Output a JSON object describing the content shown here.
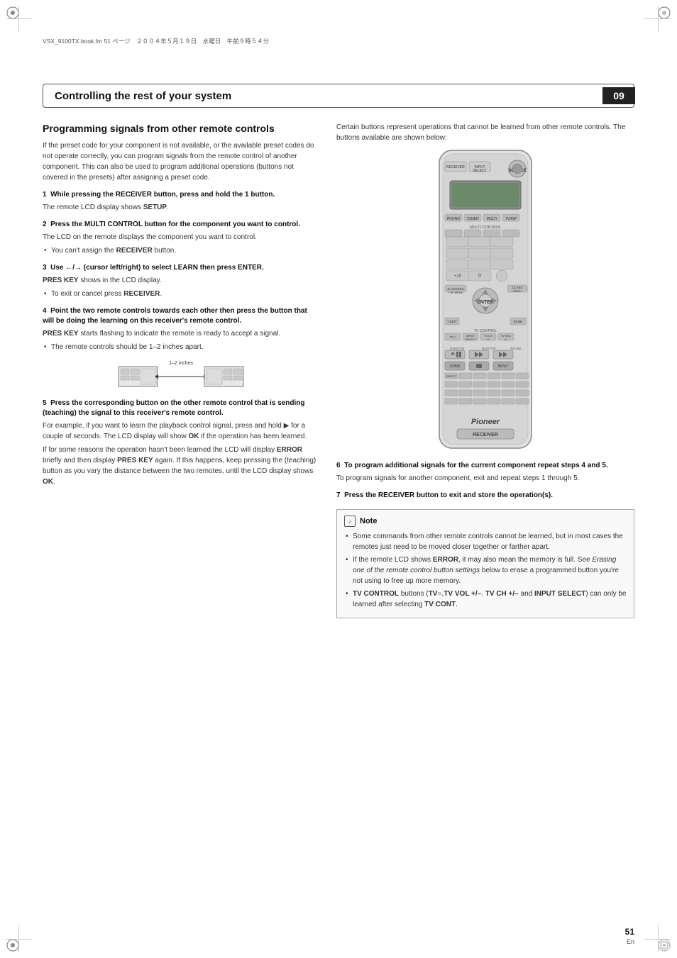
{
  "meta": {
    "file_info": "VSX_9100TX.book.fm  51 ページ　２００４年５月１９日　水曜日　午前９時５４分",
    "chapter_number": "09",
    "page_number": "51",
    "page_lang": "En"
  },
  "header": {
    "title": "Controlling the rest of your system"
  },
  "section": {
    "title": "Programming signals from other remote controls",
    "intro": "If the preset code for your component is not available, or the available preset codes do not operate correctly, you can program signals from the remote control of another component. This can also be used to program additional operations (buttons not covered in the presets) after assigning a preset code.",
    "steps": [
      {
        "id": 1,
        "heading": "1  While pressing the RECEIVER button, press and hold the 1 button.",
        "body": "The remote LCD display shows SETUP.",
        "bold_words": [
          "SETUP"
        ],
        "bullets": []
      },
      {
        "id": 2,
        "heading": "2  Press the MULTI CONTROL button for the component you want to control.",
        "body": "The LCD on the remote displays the component you want to control.",
        "bullets": [
          "You can't assign the RECEIVER button."
        ],
        "bullet_bold": [
          "RECEIVER"
        ]
      },
      {
        "id": 3,
        "heading": "3  Use ←/→ (cursor left/right) to select LEARN then press ENTER.",
        "body_lines": [
          "PRES KEY shows in the LCD display."
        ],
        "bullets": [
          "To exit or cancel press RECEIVER."
        ],
        "bullet_bold": [
          "RECEIVER"
        ],
        "bold_words": [
          "PRES KEY"
        ]
      },
      {
        "id": 4,
        "heading": "4  Point the two remote controls towards each other then press the button that will be doing the learning on this receiver's remote control.",
        "body_lines": [
          "PRES KEY starts flashing to indicate the remote is ready to accept a signal."
        ],
        "bullets": [
          "The remote controls should be 1–2 inches apart."
        ],
        "bold_words": [
          "PRES KEY"
        ]
      },
      {
        "id": 5,
        "heading": "5  Press the corresponding button on the other remote control that is sending (teaching) the signal to this receiver's remote control.",
        "body_lines": [
          "For example, if you want to learn the playback control signal, press and hold ▶ for a couple of seconds. The LCD display will show OK if the operation has been learned.",
          "If for some reasons the operation hasn't been learned the LCD will display ERROR briefly and then display PRES KEY again. If this happens, keep pressing the (teaching) button as you vary the distance between the two remotes, until the LCD display shows OK."
        ],
        "bold_words": [
          "OK",
          "ERROR",
          "PRES KEY",
          "OK"
        ]
      }
    ],
    "right_col_intro": "Certain buttons represent operations that cannot be learned from other remote controls. The buttons available are shown below:",
    "step6": {
      "heading": "6  To program additional signals for the current component repeat steps 4 and 5.",
      "body": "To program signals for another component, exit and repeat steps 1 through 5."
    },
    "step7": {
      "heading": "7  Press the RECEIVER button to exit and store the operation(s)."
    },
    "note": {
      "title": "Note",
      "bullets": [
        "Some commands from other remote controls cannot be learned, but in most cases the remotes just need to be moved closer together or farther apart.",
        "If the remote LCD shows ERROR, it may also mean the memory is full. See Erasing one of the remote control button settings below to erase a programmed button you're not using to free up more memory.",
        "TV CONTROL buttons (TV○,TV VOL +/– . TV CH +/– and INPUT SELECT) can only be learned after selecting TV CONT."
      ],
      "bold_words": [
        "ERROR",
        "TV CONTROL",
        "TV○,TV VOL +/–",
        "TV CH +/–",
        "INPUT SELECT",
        "TV CONT"
      ]
    },
    "illustration_label": "1–2 inches"
  }
}
